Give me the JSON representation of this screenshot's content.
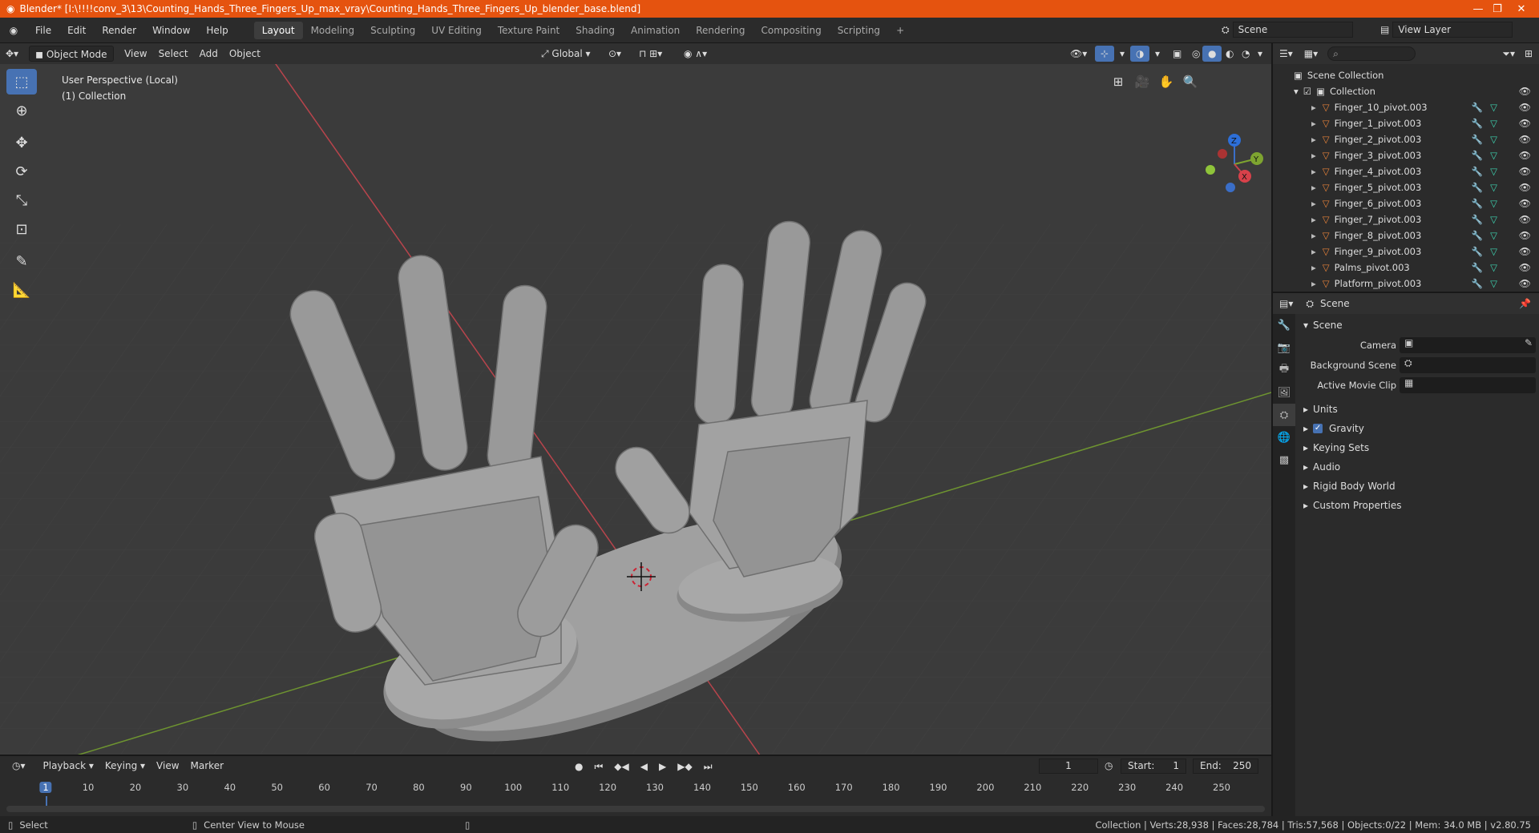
{
  "window": {
    "title": "Blender* [I:\\!!!!conv_3\\13\\Counting_Hands_Three_Fingers_Up_max_vray\\Counting_Hands_Three_Fingers_Up_blender_base.blend]",
    "controls": [
      "—",
      "❐",
      "✕"
    ]
  },
  "menus": [
    "File",
    "Edit",
    "Render",
    "Window",
    "Help"
  ],
  "workspaces": [
    "Layout",
    "Modeling",
    "Sculpting",
    "UV Editing",
    "Texture Paint",
    "Shading",
    "Animation",
    "Rendering",
    "Compositing",
    "Scripting"
  ],
  "active_workspace": "Layout",
  "scene_selector": "Scene",
  "view_layer_selector": "View Layer",
  "viewport_header": {
    "mode": "Object Mode",
    "menus": [
      "View",
      "Select",
      "Add",
      "Object"
    ],
    "transform_orientation": "Global"
  },
  "viewport": {
    "perspective": "User Perspective (Local)",
    "collection": "(1) Collection",
    "gizmo_axes": [
      "Z",
      "Y",
      "X"
    ]
  },
  "outliner": {
    "root": "Scene Collection",
    "collection": "Collection",
    "items": [
      "Finger_10_pivot.003",
      "Finger_1_pivot.003",
      "Finger_2_pivot.003",
      "Finger_3_pivot.003",
      "Finger_4_pivot.003",
      "Finger_5_pivot.003",
      "Finger_6_pivot.003",
      "Finger_7_pivot.003",
      "Finger_8_pivot.003",
      "Finger_9_pivot.003",
      "Palms_pivot.003",
      "Platform_pivot.003"
    ]
  },
  "properties": {
    "context": "Scene",
    "section": "Scene",
    "fields": [
      "Camera",
      "Background Scene",
      "Active Movie Clip"
    ],
    "panels": [
      "Units",
      "Gravity",
      "Keying Sets",
      "Audio",
      "Rigid Body World",
      "Custom Properties"
    ]
  },
  "timeline": {
    "menus": [
      "Playback",
      "Keying",
      "View",
      "Marker"
    ],
    "current_frame": "1",
    "start_label": "Start:",
    "start": "1",
    "end_label": "End:",
    "end": "250",
    "ruler": [
      "1",
      "10",
      "20",
      "30",
      "40",
      "50",
      "60",
      "70",
      "80",
      "90",
      "100",
      "110",
      "120",
      "130",
      "140",
      "150",
      "160",
      "170",
      "180",
      "190",
      "200",
      "210",
      "220",
      "230",
      "240",
      "250"
    ]
  },
  "statusbar": {
    "left": "Select",
    "middle": "Center View to Mouse",
    "stats": "Collection | Verts:28,938 | Faces:28,784 | Tris:57,568 | Objects:0/22 | Mem: 34.0 MB | v2.80.75"
  },
  "colors": {
    "titlebar": "#e5530f",
    "accent": "#4772b3",
    "viewport_bg": "#3c3c3c",
    "x_axis": "#c8414a",
    "y_axis": "#7ea430",
    "model": "#9a9a9a"
  }
}
